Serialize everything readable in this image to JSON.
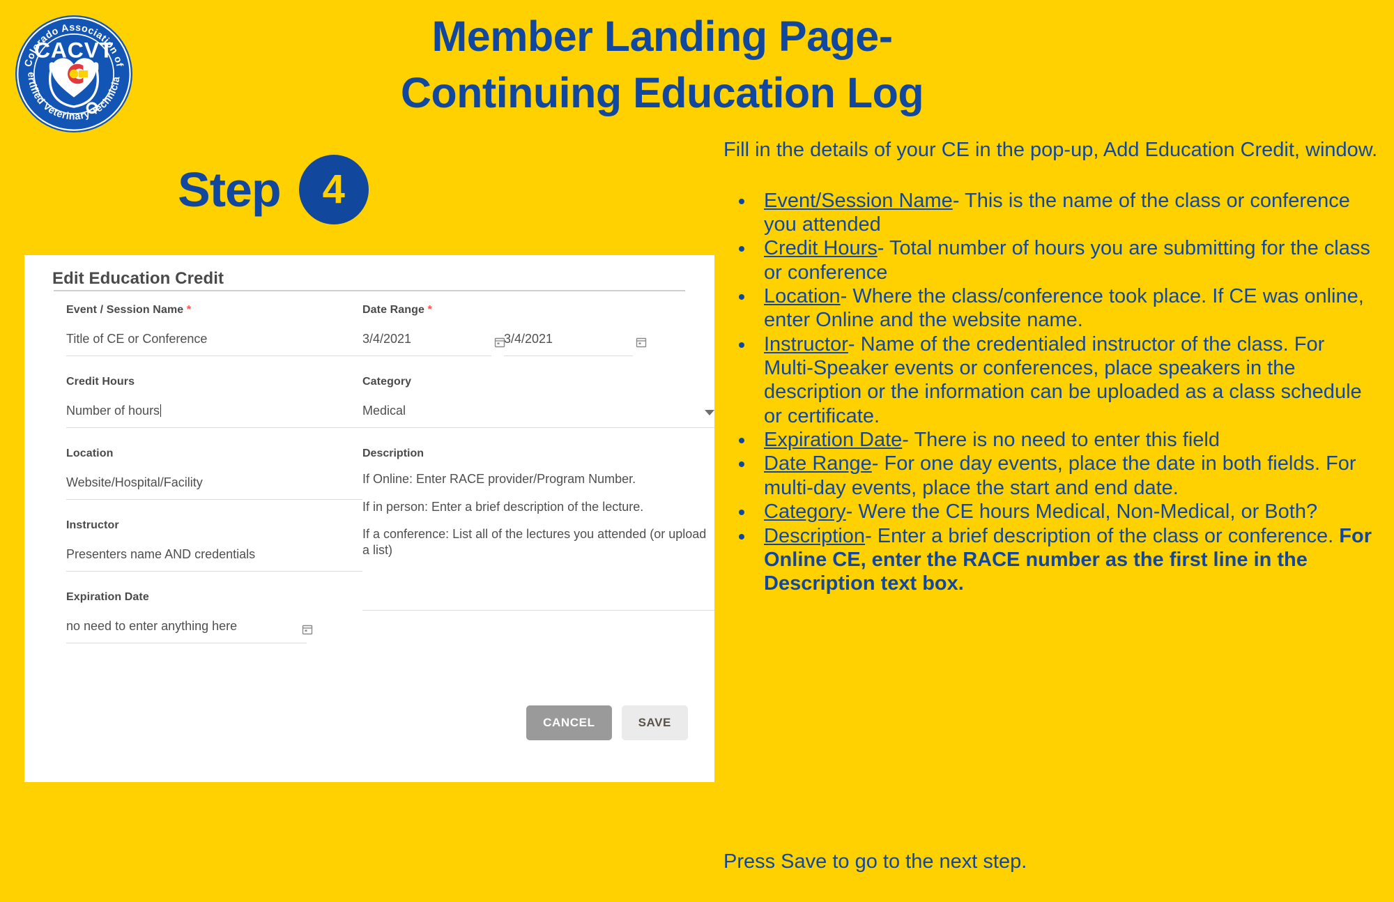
{
  "brand": {
    "accent_blue": "#11489E",
    "background_yellow": "#FFD100",
    "logo": {
      "acronym": "CACVT",
      "top_arc_text": "Colorado Association of",
      "bottom_arc_text": "Certified Veterinary Technicians"
    }
  },
  "header": {
    "title_line1": "Member Landing Page-",
    "title_line2": "Continuing Education Log"
  },
  "step": {
    "word": "Step",
    "number": "4"
  },
  "form": {
    "card_title": "Edit Education Credit",
    "fields": {
      "event_name": {
        "label": "Event / Session Name",
        "required_mark": "*",
        "value": "Title of CE or Conference"
      },
      "credit_hours": {
        "label": "Credit Hours",
        "value": "Number of hours"
      },
      "location": {
        "label": "Location",
        "value": "Website/Hospital/Facility"
      },
      "instructor": {
        "label": "Instructor",
        "value": "Presenters name AND credentials"
      },
      "expiration_date": {
        "label": "Expiration Date",
        "value": "no need to enter anything here"
      },
      "date_range": {
        "label": "Date Range",
        "required_mark": "*",
        "start_value": "3/4/2021",
        "end_value": "3/4/2021"
      },
      "category": {
        "label": "Category",
        "value": "Medical"
      },
      "description": {
        "label": "Description",
        "lines": [
          "If Online: Enter RACE provider/Program Number.",
          "If in person: Enter a brief description of the lecture.",
          "If a conference:  List all of the lectures you attended (or upload a list)"
        ]
      }
    },
    "buttons": {
      "cancel": "CANCEL",
      "save": "SAVE"
    }
  },
  "instructions": {
    "intro": "Fill in the details of your CE in the pop-up, Add Education Credit, window.",
    "bullets": [
      {
        "term": "Event/Session Name",
        "text": "- This is the name of the class or conference you attended"
      },
      {
        "term": "Credit Hours",
        "text": "- Total number of hours you are submitting for the class or conference"
      },
      {
        "term": "Location",
        "text": "- Where the class/conference took place. If CE was online, enter Online and the website name."
      },
      {
        "term": "Instructor",
        "text": "- Name of the credentialed instructor of the class.  For Multi-Speaker events or conferences, place speakers in the description or the information can be uploaded as a class schedule or certificate."
      },
      {
        "term": "Expiration Date",
        "text": "- There is no need to enter this field"
      },
      {
        "term": "Date Range",
        "text": "- For one day events, place the date in both fields.  For multi-day events, place the start and end date."
      },
      {
        "term": "Category",
        "text": "- Were the CE hours Medical, Non-Medical, or Both?"
      },
      {
        "term": "Description",
        "text": "- Enter a brief description of the class or conference. ",
        "bold_text": "For Online CE, enter the RACE number as the first line in the Description text box."
      }
    ],
    "outro": "Press Save to go to the next step."
  }
}
